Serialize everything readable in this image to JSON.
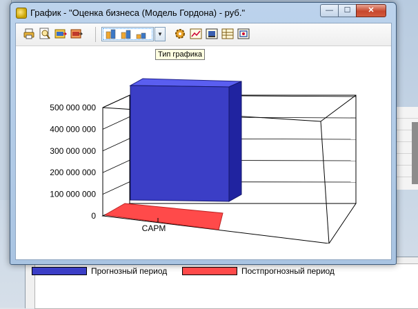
{
  "window": {
    "title": "График - \"Оценка бизнеса (Модель Гордона) - руб.\"",
    "minimize_glyph": "—",
    "maximize_glyph": "☐",
    "close_glyph": "✕"
  },
  "toolbar": {
    "buttons": [
      {
        "name": "print-icon"
      },
      {
        "name": "print-preview-icon"
      },
      {
        "name": "export-doc-icon"
      },
      {
        "name": "export-html-icon"
      },
      {
        "name": "chart-settings-icon"
      },
      {
        "name": "line-chart-icon"
      },
      {
        "name": "chart-properties-icon"
      },
      {
        "name": "table-view-icon"
      },
      {
        "name": "data-grid-icon"
      }
    ],
    "chart_type_tooltip": "Тип графика"
  },
  "colors": {
    "series1": "#3b3ec6",
    "series2": "#ff4a4a",
    "window_frame": "#a9c4e2"
  },
  "chart_data": {
    "type": "bar",
    "categories": [
      "CAPM"
    ],
    "series": [
      {
        "name": "Прогнозный период",
        "values": [
          535000000
        ]
      },
      {
        "name": "Постпрогнозный период",
        "values": [
          0
        ]
      }
    ],
    "ylim": [
      0,
      500000000
    ],
    "yticks": [
      0,
      100000000,
      200000000,
      300000000,
      400000000,
      500000000
    ],
    "ytick_labels": [
      "0",
      "100 000 000",
      "200 000 000",
      "300 000 000",
      "400 000 000",
      "500 000 000"
    ],
    "xtick_labels": [
      "CAPM"
    ],
    "grid": true,
    "legend_position": "bottom",
    "three_d": true
  }
}
